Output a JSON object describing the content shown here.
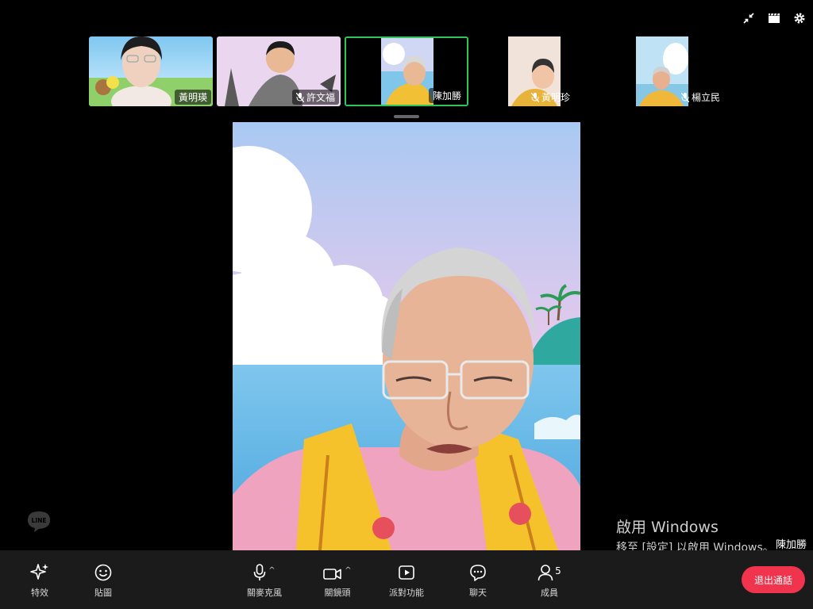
{
  "participants": [
    {
      "name": "黃明瑛",
      "muted": false
    },
    {
      "name": "許文福",
      "muted": true
    },
    {
      "name": "陳加勝",
      "muted": false,
      "active": true
    },
    {
      "name": "黃明珍",
      "muted": true
    },
    {
      "name": "楊立民",
      "muted": true
    }
  ],
  "main_speaker": "陳加勝",
  "watermark": {
    "line1": "啟用 Windows",
    "line2": "移至 [設定] 以啟用 Windows。"
  },
  "logo": "LINE",
  "toolbar": {
    "effects": "特效",
    "stickers": "貼圖",
    "microphone": "關麥克風",
    "camera": "關鏡頭",
    "party": "派對功能",
    "chat": "聊天",
    "members": "成員",
    "member_count": "5",
    "leave": "退出通話"
  },
  "colors": {
    "active_border": "#2fc55a",
    "leave_button": "#f0344e",
    "toolbar_bg": "#1b1b1b"
  },
  "icons": [
    "shrink-icon",
    "clapper-icon",
    "gear-icon",
    "sparkle-icon",
    "smiley-icon",
    "microphone-icon",
    "camera-icon",
    "party-icon",
    "chat-icon",
    "person-icon",
    "mic-muted-icon"
  ]
}
